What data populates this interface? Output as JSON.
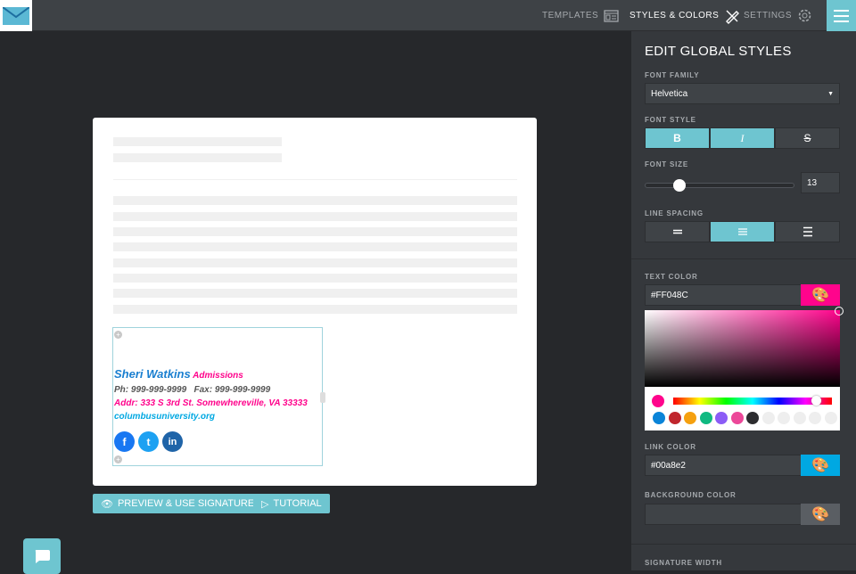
{
  "nav": {
    "templates": "TEMPLATES",
    "styles": "STYLES & COLORS",
    "settings": "SETTINGS"
  },
  "signature": {
    "name": "Sheri Watkins",
    "title": "Admissions",
    "phone": "Ph: 999-999-9999",
    "fax": "Fax: 999-999-9999",
    "address": "Addr: 333 S 3rd St. Somewhereville, VA 33333",
    "website": "columbusuniversity.org",
    "social": [
      "f",
      "t",
      "in"
    ]
  },
  "buttons": {
    "preview": "PREVIEW & USE SIGNATURE",
    "tutorial": "TUTORIAL"
  },
  "panel": {
    "title": "EDIT GLOBAL STYLES",
    "font_family_label": "FONT FAMILY",
    "font_family": "Helvetica",
    "font_style_label": "FONT STYLE",
    "bold": "B",
    "italic": "I",
    "strike": "S",
    "font_size_label": "FONT SIZE",
    "font_size": "13",
    "line_spacing_label": "LINE SPACING",
    "text_color_label": "TEXT COLOR",
    "text_color": "#FF048C",
    "link_color_label": "LINK COLOR",
    "link_color": "#00a8e2",
    "bg_color_label": "BACKGROUND COLOR",
    "bg_color": "",
    "sig_width_label": "SIGNATURE WIDTH"
  },
  "colors": {
    "accent": "#6ec5d0",
    "text": "#FF048C",
    "link": "#00a8e2",
    "name": "#1a7fd0"
  },
  "swatches": [
    "#0a84d8",
    "#c0262d",
    "#f5a00f",
    "#10b981",
    "#8b5cf6",
    "#ec4899",
    "#2d2d30",
    "#eeeeee",
    "#eeeeee",
    "#eeeeee",
    "#eeeeee",
    "#eeeeee"
  ]
}
